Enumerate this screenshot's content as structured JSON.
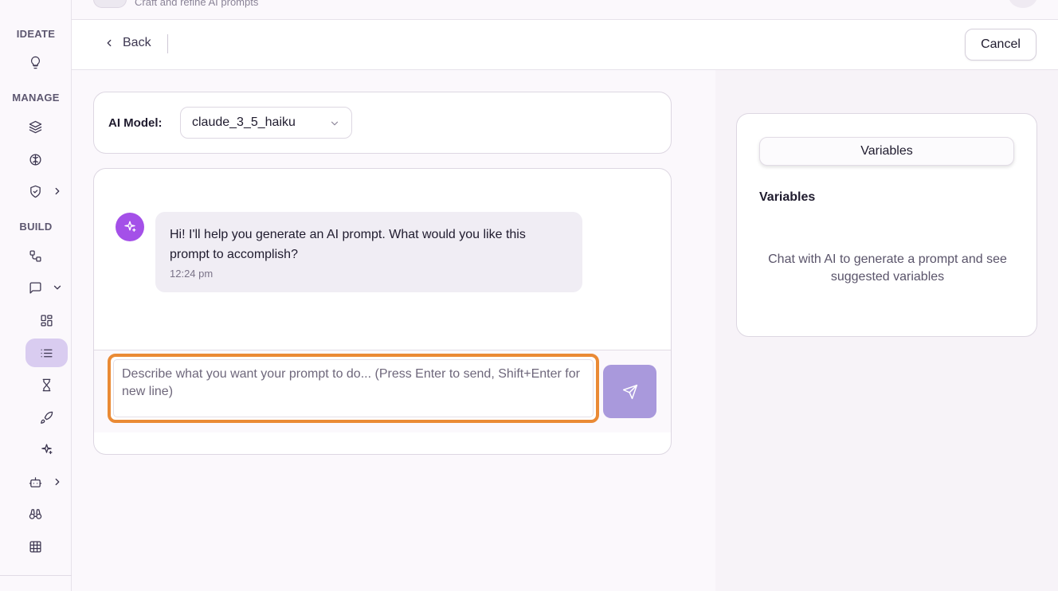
{
  "topbar": {
    "subtitle": "Craft and refine AI prompts"
  },
  "sidebar": {
    "sections": {
      "ideate": "IDEATE",
      "manage": "MANAGE",
      "build": "BUILD"
    },
    "icons": [
      "lightbulb-icon",
      "layers-icon",
      "brain-icon",
      "shield-check-icon",
      "workflow-icon",
      "message-square-icon",
      "layout-grid-icon",
      "list-icon",
      "hourglass-icon",
      "rocket-icon",
      "sparkles-icon",
      "bot-icon",
      "binoculars-icon",
      "table-icon"
    ],
    "active_item": "list-icon"
  },
  "header": {
    "back_label": "Back",
    "cancel_label": "Cancel"
  },
  "model": {
    "label": "AI Model:",
    "selected": "claude_3_5_haiku"
  },
  "chat": {
    "messages": [
      {
        "sender": "assistant",
        "text": "Hi! I'll help you generate an AI prompt. What would you like this prompt to accomplish?",
        "time": "12:24 pm"
      }
    ],
    "input_placeholder": "Describe what you want your prompt to do... (Press Enter to send, Shift+Enter for new line)",
    "input_value": ""
  },
  "variables": {
    "tab_label": "Variables",
    "heading": "Variables",
    "empty_text": "Chat with AI to generate a prompt and see suggested variables"
  },
  "colors": {
    "accent_purple": "#a450e8",
    "send_button": "#a999dc",
    "active_nav": "#d9ccf0",
    "highlight_orange": "#ea8a35"
  }
}
